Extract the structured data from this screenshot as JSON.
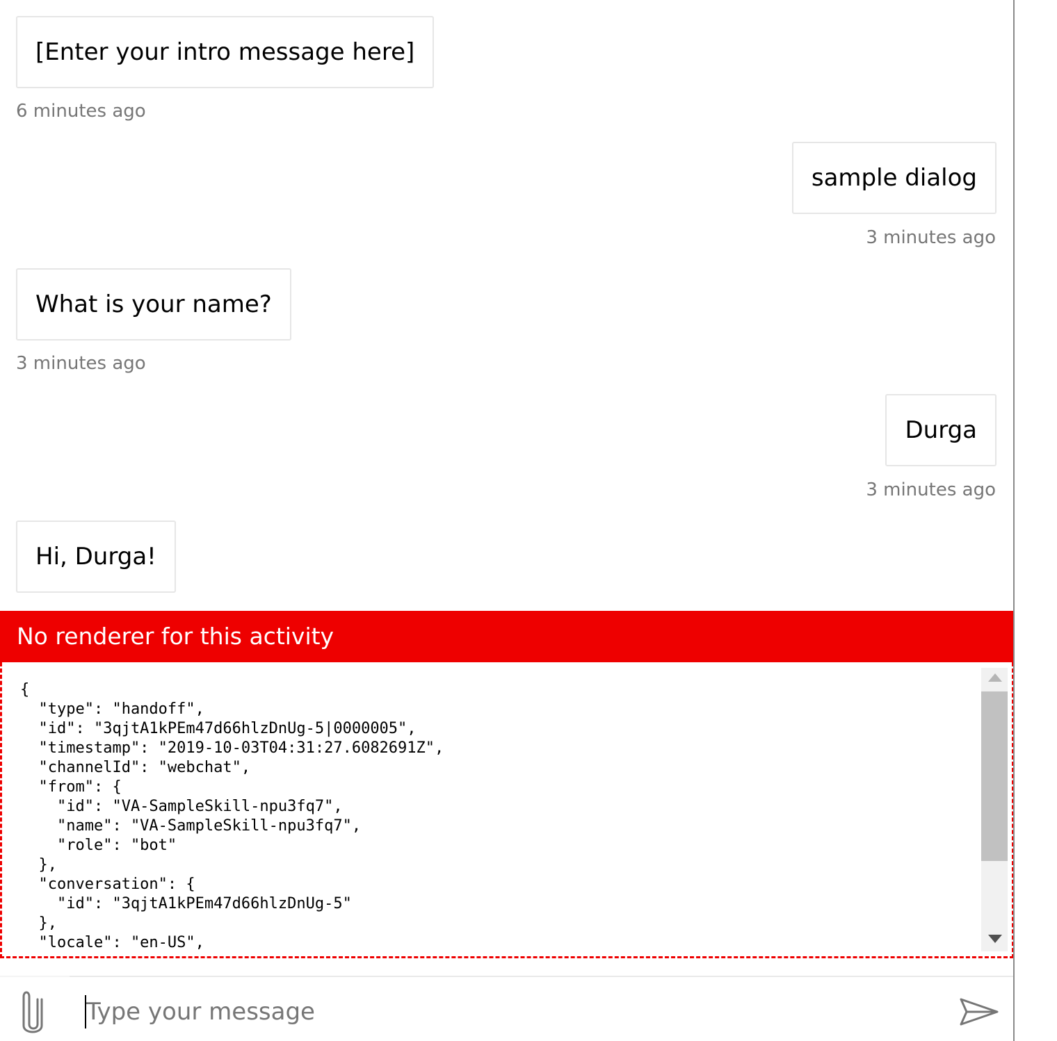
{
  "messages": [
    {
      "side": "bot",
      "text": "[Enter your intro message here]",
      "time": "6 minutes ago"
    },
    {
      "side": "user",
      "text": "sample dialog",
      "time": "3 minutes ago"
    },
    {
      "side": "bot",
      "text": "What is your name?",
      "time": "3 minutes ago"
    },
    {
      "side": "user",
      "text": "Durga",
      "time": "3 minutes ago"
    },
    {
      "side": "bot",
      "text": "Hi, Durga!",
      "time": ""
    }
  ],
  "error_activity": {
    "header": "No renderer for this activity",
    "json_text": "{\n  \"type\": \"handoff\",\n  \"id\": \"3qjtA1kPEm47d66hlzDnUg-5|0000005\",\n  \"timestamp\": \"2019-10-03T04:31:27.6082691Z\",\n  \"channelId\": \"webchat\",\n  \"from\": {\n    \"id\": \"VA-SampleSkill-npu3fq7\",\n    \"name\": \"VA-SampleSkill-npu3fq7\",\n    \"role\": \"bot\"\n  },\n  \"conversation\": {\n    \"id\": \"3qjtA1kPEm47d66hlzDnUg-5\"\n  },\n  \"locale\": \"en-US\","
  },
  "composer": {
    "placeholder": "Type your message",
    "attach_icon": "paperclip-icon",
    "send_icon": "send-icon"
  },
  "colors": {
    "error_red": "#ee0000",
    "timestamp_gray": "#767676",
    "bubble_border": "#e6e6e6"
  }
}
